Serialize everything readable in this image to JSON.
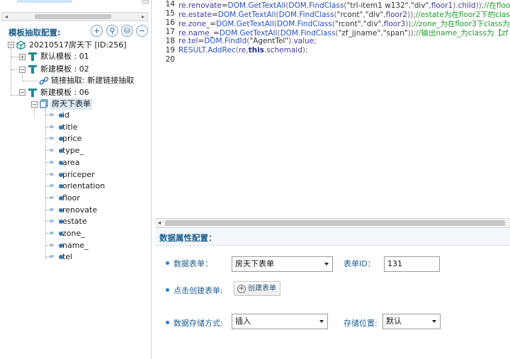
{
  "left_panel": {
    "title": "模板抽取配置:",
    "tool_icons": [
      "add-icon",
      "link-add-icon",
      "database-icon",
      "remove-icon"
    ],
    "tool_glyphs": [
      "+",
      "⚲",
      "⛁",
      "−"
    ],
    "root": {
      "label": "20210517房天下 [ID:256]",
      "expander": "−"
    },
    "templates": [
      {
        "label": "默认模板 : 01",
        "expander": "+"
      },
      {
        "label": "新建模板 : 02",
        "expander": "−"
      },
      {
        "label": "新建模板 : 06",
        "expander": "−"
      }
    ],
    "link_extract": "链接抽取: 新建链接抽取",
    "table_node": {
      "label": "房天下表单",
      "expander": "−"
    },
    "fields": [
      "id",
      "title",
      "price",
      "type_",
      "area",
      "priceper",
      "orientation",
      "floor",
      "renovate",
      "estate",
      "zone_",
      "name_",
      "tel"
    ],
    "field_glyph": "=●"
  },
  "code": {
    "line_numbers": [
      "14",
      "15",
      "16",
      "17",
      "18",
      "19",
      "20"
    ],
    "lines": [
      [
        [
          "var",
          "re.renovate"
        ],
        [
          "eq",
          "="
        ],
        [
          "obj",
          "DOM"
        ],
        [
          "punc",
          "."
        ],
        [
          "fn",
          "GetTextAll"
        ],
        [
          "punc",
          "("
        ],
        [
          "obj",
          "DOM"
        ],
        [
          "punc",
          "."
        ],
        [
          "fn",
          "FindClass"
        ],
        [
          "punc",
          "("
        ],
        [
          "str",
          "\"trl-item1 w132\""
        ],
        [
          "punc",
          ","
        ],
        [
          "str",
          "\"div\""
        ],
        [
          "punc",
          ","
        ],
        [
          "var",
          "floor1"
        ],
        [
          "punc",
          ")."
        ],
        [
          "var",
          "child"
        ],
        [
          "punc",
          "));"
        ],
        [
          "cm",
          "//在floor"
        ]
      ],
      [
        [
          "var",
          "re.estate"
        ],
        [
          "eq",
          "="
        ],
        [
          "obj",
          "DOM"
        ],
        [
          "punc",
          "."
        ],
        [
          "fn",
          "GetTextAll"
        ],
        [
          "punc",
          "("
        ],
        [
          "obj",
          "DOM"
        ],
        [
          "punc",
          "."
        ],
        [
          "fn",
          "FindClass"
        ],
        [
          "punc",
          "("
        ],
        [
          "str",
          "\"rcont\""
        ],
        [
          "punc",
          ","
        ],
        [
          "str",
          "\"div\""
        ],
        [
          "punc",
          ","
        ],
        [
          "var",
          "floor2"
        ],
        [
          "punc",
          "));"
        ],
        [
          "cm",
          "//estate为在floor2下的clas"
        ]
      ],
      [
        [
          "var",
          "re.zone_"
        ],
        [
          "eq",
          "="
        ],
        [
          "obj",
          "DOM"
        ],
        [
          "punc",
          "."
        ],
        [
          "fn",
          "GetTextAll"
        ],
        [
          "punc",
          "("
        ],
        [
          "obj",
          "DOM"
        ],
        [
          "punc",
          "."
        ],
        [
          "fn",
          "FindClass"
        ],
        [
          "punc",
          "("
        ],
        [
          "str",
          "\"rcont\""
        ],
        [
          "punc",
          ","
        ],
        [
          "str",
          "\"div\""
        ],
        [
          "punc",
          ","
        ],
        [
          "var",
          "floor3"
        ],
        [
          "punc",
          "));"
        ],
        [
          "cm",
          "//zone_为在floor3下class为"
        ]
      ],
      [
        [
          "var",
          "re.name_"
        ],
        [
          "eq",
          "="
        ],
        [
          "obj",
          "DOM"
        ],
        [
          "punc",
          "."
        ],
        [
          "fn",
          "GetTextAll"
        ],
        [
          "punc",
          "("
        ],
        [
          "obj",
          "DOM"
        ],
        [
          "punc",
          "."
        ],
        [
          "fn",
          "FindClass"
        ],
        [
          "punc",
          "("
        ],
        [
          "str",
          "\"zf_jjname\""
        ],
        [
          "punc",
          ","
        ],
        [
          "str",
          "\"span\""
        ],
        [
          "punc",
          "));"
        ],
        [
          "cm",
          "//输出name_为class为【zf"
        ]
      ],
      [
        [
          "var",
          "re.tel"
        ],
        [
          "eq",
          "="
        ],
        [
          "obj",
          "DOM"
        ],
        [
          "punc",
          "."
        ],
        [
          "fn",
          "FindId"
        ],
        [
          "punc",
          "("
        ],
        [
          "str",
          "\"AgentTel\""
        ],
        [
          "punc",
          ")."
        ],
        [
          "var",
          "value"
        ],
        [
          "punc",
          ";"
        ]
      ],
      [
        [
          "obj",
          "RESULT"
        ],
        [
          "punc",
          "."
        ],
        [
          "fn",
          "AddRec"
        ],
        [
          "punc",
          "("
        ],
        [
          "var",
          "re"
        ],
        [
          "punc",
          ","
        ],
        [
          "kw",
          "this"
        ],
        [
          "punc",
          "."
        ],
        [
          "sch",
          "schemaid"
        ],
        [
          "punc",
          ");"
        ]
      ],
      []
    ],
    "scroll_left_glyph": "◂",
    "left_scroll_glyphs": [
      "◂",
      "▸"
    ]
  },
  "props": {
    "title": "数据属性配置：",
    "data_table_label": "数据表单：",
    "data_table_value": "房天下表单",
    "table_id_label": "表单ID：",
    "table_id_value": "131",
    "click_create_label": "点击创建表单:",
    "create_button_label": "创建表单",
    "create_button_glyph": "+",
    "storage_mode_label": "数据存储方式:",
    "storage_mode_value": "插入",
    "storage_location_label": "存储位置:",
    "storage_location_value": "默认"
  }
}
